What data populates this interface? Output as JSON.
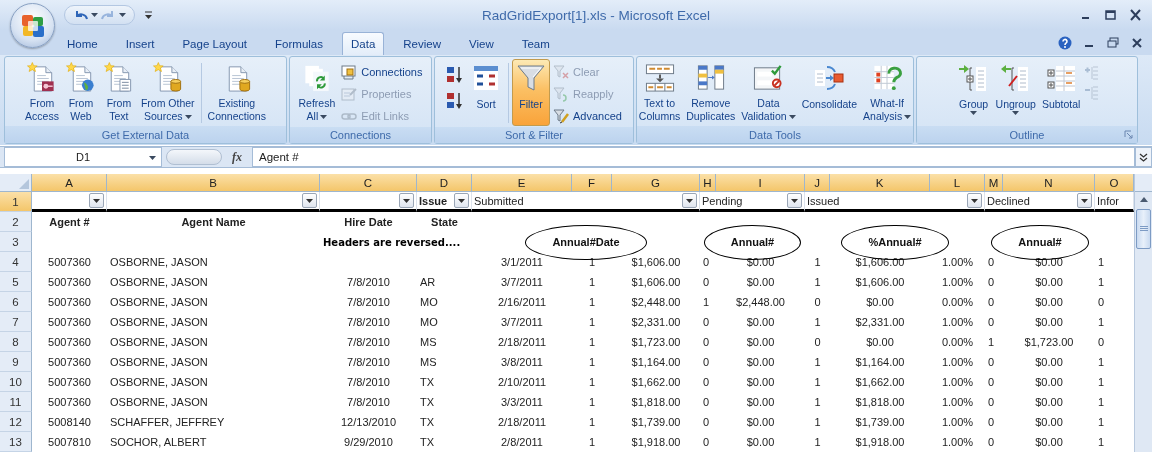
{
  "window": {
    "title": "RadGridExport[1].xls - Microsoft Excel"
  },
  "quick_access": [
    {
      "kind": "undo",
      "disabled": false
    },
    {
      "kind": "redo",
      "disabled": true
    }
  ],
  "tabs": [
    {
      "label": "Home",
      "selected": false
    },
    {
      "label": "Insert",
      "selected": false
    },
    {
      "label": "Page Layout",
      "selected": false
    },
    {
      "label": "Formulas",
      "selected": false
    },
    {
      "label": "Data",
      "selected": true
    },
    {
      "label": "Review",
      "selected": false
    },
    {
      "label": "View",
      "selected": false
    },
    {
      "label": "Team",
      "selected": false
    }
  ],
  "ribbon": [
    {
      "label": "Get External Data",
      "dialog_launcher": false,
      "items": [
        {
          "kind": "large",
          "label": "From\nAccess",
          "dropdown": false,
          "selected": false
        },
        {
          "kind": "large",
          "label": "From\nWeb",
          "dropdown": false,
          "selected": false
        },
        {
          "kind": "large",
          "label": "From\nText",
          "dropdown": false,
          "selected": false
        },
        {
          "kind": "large",
          "label": "From Other\nSources",
          "dropdown": true,
          "selected": false
        },
        {
          "kind": "separator"
        },
        {
          "kind": "large",
          "label": "Existing\nConnections",
          "dropdown": false,
          "selected": false
        }
      ]
    },
    {
      "label": "Connections",
      "dialog_launcher": false,
      "items": [
        {
          "kind": "large",
          "label": "Refresh\nAll",
          "dropdown": true,
          "selected": false
        },
        {
          "kind": "stack",
          "buttons": [
            {
              "label": "Connections",
              "disabled": false
            },
            {
              "label": "Properties",
              "disabled": true
            },
            {
              "label": "Edit Links",
              "disabled": true
            }
          ]
        }
      ]
    },
    {
      "label": "Sort & Filter",
      "dialog_launcher": false,
      "items": [
        {
          "kind": "sort_pair"
        },
        {
          "kind": "large",
          "label": "Sort",
          "dropdown": false,
          "selected": false
        },
        {
          "kind": "separator"
        },
        {
          "kind": "large",
          "label": "Filter",
          "dropdown": false,
          "selected": true
        },
        {
          "kind": "stack",
          "buttons": [
            {
              "label": "Clear",
              "disabled": true
            },
            {
              "label": "Reapply",
              "disabled": true
            },
            {
              "label": "Advanced",
              "disabled": false
            }
          ]
        }
      ]
    },
    {
      "label": "Data Tools",
      "dialog_launcher": false,
      "items": [
        {
          "kind": "large",
          "label": "Text to\nColumns",
          "dropdown": false,
          "selected": false
        },
        {
          "kind": "large",
          "label": "Remove\nDuplicates",
          "dropdown": false,
          "selected": false
        },
        {
          "kind": "large",
          "label": "Data\nValidation",
          "dropdown": true,
          "selected": false
        },
        {
          "kind": "large",
          "label": "Consolidate",
          "dropdown": false,
          "selected": false
        },
        {
          "kind": "large",
          "label": "What-If\nAnalysis",
          "dropdown": true,
          "selected": false
        }
      ]
    },
    {
      "label": "Outline",
      "dialog_launcher": true,
      "items": [
        {
          "kind": "large",
          "label": "Group",
          "dropdown": true,
          "selected": false
        },
        {
          "kind": "large",
          "label": "Ungroup",
          "dropdown": true,
          "selected": false
        },
        {
          "kind": "large",
          "label": "Subtotal",
          "dropdown": false,
          "selected": false
        },
        {
          "kind": "mini_stack",
          "buttons": [
            {
              "disabled": true
            },
            {
              "disabled": true
            }
          ]
        }
      ]
    }
  ],
  "sheet": {
    "name_box": "D1",
    "function_button": "fx",
    "formula": "Agent #",
    "columns": [
      {
        "letter": "A",
        "selected": true
      },
      {
        "letter": "B",
        "selected": true
      },
      {
        "letter": "C",
        "selected": true
      },
      {
        "letter": "D",
        "selected": true
      },
      {
        "letter": "E",
        "selected": true
      },
      {
        "letter": "F",
        "selected": true
      },
      {
        "letter": "G",
        "selected": true
      },
      {
        "letter": "H",
        "selected": true
      },
      {
        "letter": "I",
        "selected": true
      },
      {
        "letter": "J",
        "selected": true
      },
      {
        "letter": "K",
        "selected": true
      },
      {
        "letter": "L",
        "selected": true
      },
      {
        "letter": "M",
        "selected": true
      },
      {
        "letter": "N",
        "selected": true
      },
      {
        "letter": "O",
        "selected": true
      }
    ],
    "filter_row": {
      "number": "1",
      "selected": true,
      "cells": [
        {
          "filter": true
        },
        {
          "filter": true
        },
        {
          "filter": true
        },
        {
          "text": "Issue",
          "bold": true,
          "filter": true
        },
        {
          "text": "Submitted",
          "bold": false,
          "filter": true
        },
        null,
        null,
        {
          "text": "Pending",
          "bold": false,
          "filter": true
        },
        null,
        {
          "text": "Issued",
          "bold": false,
          "filter": true
        },
        null,
        null,
        {
          "text": "Declined",
          "bold": false,
          "filter": true
        },
        null,
        {
          "text": "Infor",
          "bold": false,
          "filter": false
        }
      ]
    },
    "header_row": {
      "number": "2",
      "selected": false,
      "cells": [
        {
          "text": "Agent #"
        },
        {
          "text": "Agent Name"
        },
        {
          "text": "Hire Date"
        },
        {
          "text": "State"
        }
      ]
    },
    "note_row": {
      "number": "3",
      "selected": false,
      "cells": [
        null,
        null,
        {
          "text": "Headers are reversed....",
          "kind": "note"
        },
        null,
        {
          "text": "Annual#Date",
          "kind": "label",
          "circled": true
        },
        null,
        null,
        {
          "text": "Annual#",
          "kind": "label",
          "circled": true
        },
        null,
        {
          "text": "%Annual#",
          "kind": "label",
          "circled": true
        },
        null,
        null,
        {
          "text": "Annual#",
          "kind": "label",
          "circled": true
        },
        null
      ]
    },
    "rows": [
      {
        "number": "4",
        "selected": false,
        "cells": [
          "5007360",
          "OSBORNE, JASON",
          null,
          null,
          "3/1/2011",
          "1",
          "$1,606.00",
          "0",
          "$0.00",
          "1",
          "$1,606.00",
          "1.00%",
          "0",
          "$0.00",
          "1"
        ]
      },
      {
        "number": "5",
        "selected": false,
        "cells": [
          "5007360",
          "OSBORNE, JASON",
          "7/8/2010",
          "AR",
          "3/7/2011",
          "1",
          "$1,606.00",
          "0",
          "$0.00",
          "1",
          "$1,606.00",
          "1.00%",
          "0",
          "$0.00",
          "1"
        ]
      },
      {
        "number": "6",
        "selected": false,
        "cells": [
          "5007360",
          "OSBORNE, JASON",
          "7/8/2010",
          "MO",
          "2/16/2011",
          "1",
          "$2,448.00",
          "1",
          "$2,448.00",
          "0",
          "$0.00",
          "0.00%",
          "0",
          "$0.00",
          "0"
        ]
      },
      {
        "number": "7",
        "selected": false,
        "cells": [
          "5007360",
          "OSBORNE, JASON",
          "7/8/2010",
          "MO",
          "3/7/2011",
          "1",
          "$2,331.00",
          "0",
          "$0.00",
          "1",
          "$2,331.00",
          "1.00%",
          "0",
          "$0.00",
          "1"
        ]
      },
      {
        "number": "8",
        "selected": false,
        "cells": [
          "5007360",
          "OSBORNE, JASON",
          "7/8/2010",
          "MS",
          "2/18/2011",
          "1",
          "$1,723.00",
          "0",
          "$0.00",
          "0",
          "$0.00",
          "0.00%",
          "1",
          "$1,723.00",
          "0"
        ]
      },
      {
        "number": "9",
        "selected": false,
        "cells": [
          "5007360",
          "OSBORNE, JASON",
          "7/8/2010",
          "MS",
          "3/8/2011",
          "1",
          "$1,164.00",
          "0",
          "$0.00",
          "1",
          "$1,164.00",
          "1.00%",
          "0",
          "$0.00",
          "1"
        ]
      },
      {
        "number": "10",
        "selected": false,
        "cells": [
          "5007360",
          "OSBORNE, JASON",
          "7/8/2010",
          "TX",
          "2/10/2011",
          "1",
          "$1,662.00",
          "0",
          "$0.00",
          "1",
          "$1,662.00",
          "1.00%",
          "0",
          "$0.00",
          "1"
        ]
      },
      {
        "number": "11",
        "selected": false,
        "cells": [
          "5007360",
          "OSBORNE, JASON",
          "7/8/2010",
          "TX",
          "3/3/2011",
          "1",
          "$1,818.00",
          "0",
          "$0.00",
          "1",
          "$1,818.00",
          "1.00%",
          "0",
          "$0.00",
          "1"
        ]
      },
      {
        "number": "12",
        "selected": false,
        "cells": [
          "5008140",
          "SCHAFFER, JEFFREY",
          "12/13/2010",
          "TX",
          "2/18/2011",
          "1",
          "$1,739.00",
          "0",
          "$0.00",
          "1",
          "$1,739.00",
          "1.00%",
          "0",
          "$0.00",
          "1"
        ]
      },
      {
        "number": "13",
        "selected": false,
        "cells": [
          "5007810",
          "SOCHOR, ALBERT",
          "9/29/2010",
          "TX",
          "2/8/2011",
          "1",
          "$1,918.00",
          "0",
          "$0.00",
          "1",
          "$1,918.00",
          "1.00%",
          "0",
          "$0.00",
          "1"
        ]
      }
    ]
  }
}
